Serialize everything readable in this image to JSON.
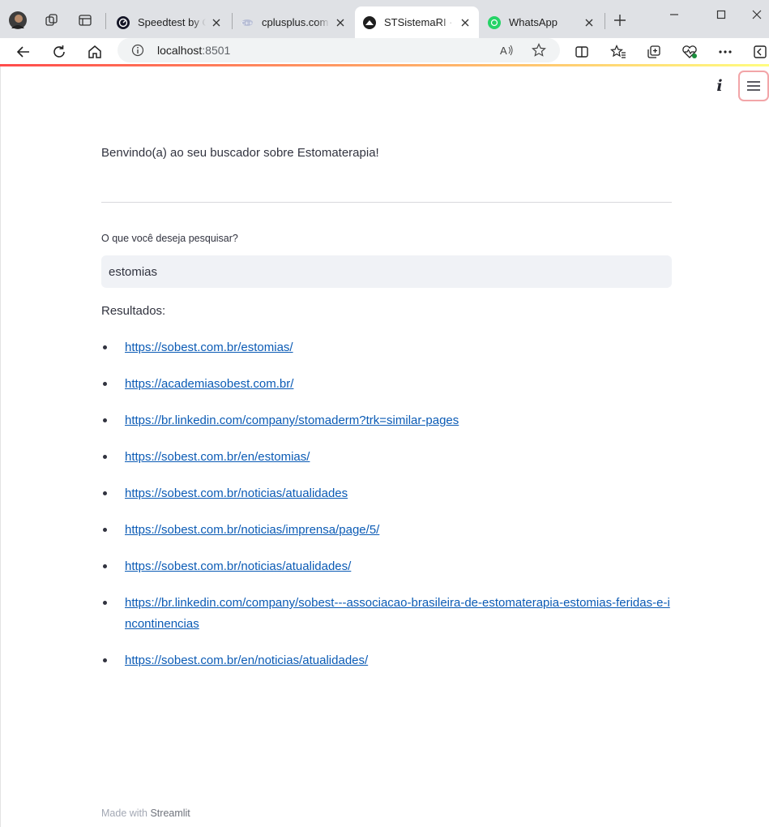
{
  "browser": {
    "tabs": [
      {
        "title": "Speedtest by Ookla",
        "favicon": "speedtest-icon",
        "active": false
      },
      {
        "title": "cplusplus.com",
        "favicon": "cplusplus-icon",
        "active": false
      },
      {
        "title": "STSistemaRI · Streamlit",
        "favicon": "streamlit-icon",
        "active": true
      },
      {
        "title": "WhatsApp",
        "favicon": "whatsapp-icon",
        "active": false
      }
    ],
    "address": {
      "host": "localhost",
      "port": ":8501"
    }
  },
  "app": {
    "welcome": "Benvindo(a) ao seu buscador sobre Estomaterapia!",
    "search": {
      "label": "O que você deseja pesquisar?",
      "value": "estomias"
    },
    "results_label": "Resultados:",
    "results": [
      "https://sobest.com.br/estomias/",
      "https://academiasobest.com.br/",
      "https://br.linkedin.com/company/stomaderm?trk=similar-pages",
      "https://sobest.com.br/en/estomias/",
      "https://sobest.com.br/noticias/atualidades",
      "https://sobest.com.br/noticias/imprensa/page/5/",
      "https://sobest.com.br/noticias/atualidades/",
      "https://br.linkedin.com/company/sobest---associacao-brasileira-de-estomaterapia-estomias-feridas-e-incontinencias",
      "https://sobest.com.br/en/noticias/atualidades/"
    ],
    "footer": {
      "prefix": "Made with",
      "brand": "Streamlit"
    }
  },
  "colors": {
    "link": "#0b5bb5",
    "accent": "#ff4b4b",
    "input_bg": "#f0f2f6"
  }
}
